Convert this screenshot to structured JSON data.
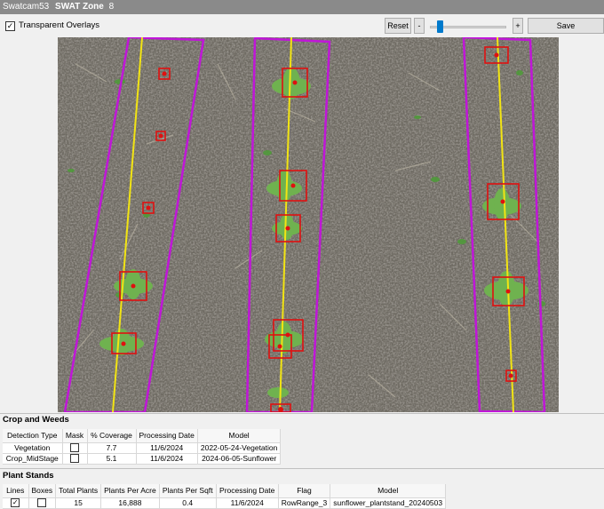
{
  "window": {
    "title": "Swatcam53",
    "zone_label": "SWAT Zone",
    "zone_number": "8"
  },
  "toolbar": {
    "overlay_label": "Transparent Overlays",
    "overlay_checked": "✓",
    "reset_label": "Reset",
    "minus_label": "-",
    "plus_label": "+",
    "save_label": "Save",
    "zoom_level": 0.1
  },
  "colors": {
    "row_boundary": "#c016d8",
    "row_center": "#f2e413",
    "detection_box": "#e01010",
    "soil": "#6e6a62"
  },
  "crop_weeds": {
    "title": "Crop and Weeds",
    "columns": [
      "Detection Type",
      "Mask",
      "% Coverage",
      "Processing Date",
      "Model"
    ],
    "rows": [
      {
        "type": "Vegetation",
        "coverage": "7.7",
        "date": "11/6/2024",
        "model": "2022-05-24-Vegetation"
      },
      {
        "type": "Crop_MidStage",
        "coverage": "5.1",
        "date": "11/6/2024",
        "model": "2024-06-05-Sunflower"
      }
    ]
  },
  "plant_stands": {
    "title": "Plant Stands",
    "columns": [
      "Lines",
      "Boxes",
      "Total Plants",
      "Plants Per Acre",
      "Plants Per Sqft",
      "Processing Date",
      "Flag",
      "Model"
    ],
    "row": {
      "lines_mark": "✓",
      "total": "15",
      "per_acre": "16,888",
      "per_sqft": "0.4",
      "date": "11/6/2024",
      "flag": "RowRange_3",
      "model": "sunflower_plantstand_20240503"
    }
  }
}
